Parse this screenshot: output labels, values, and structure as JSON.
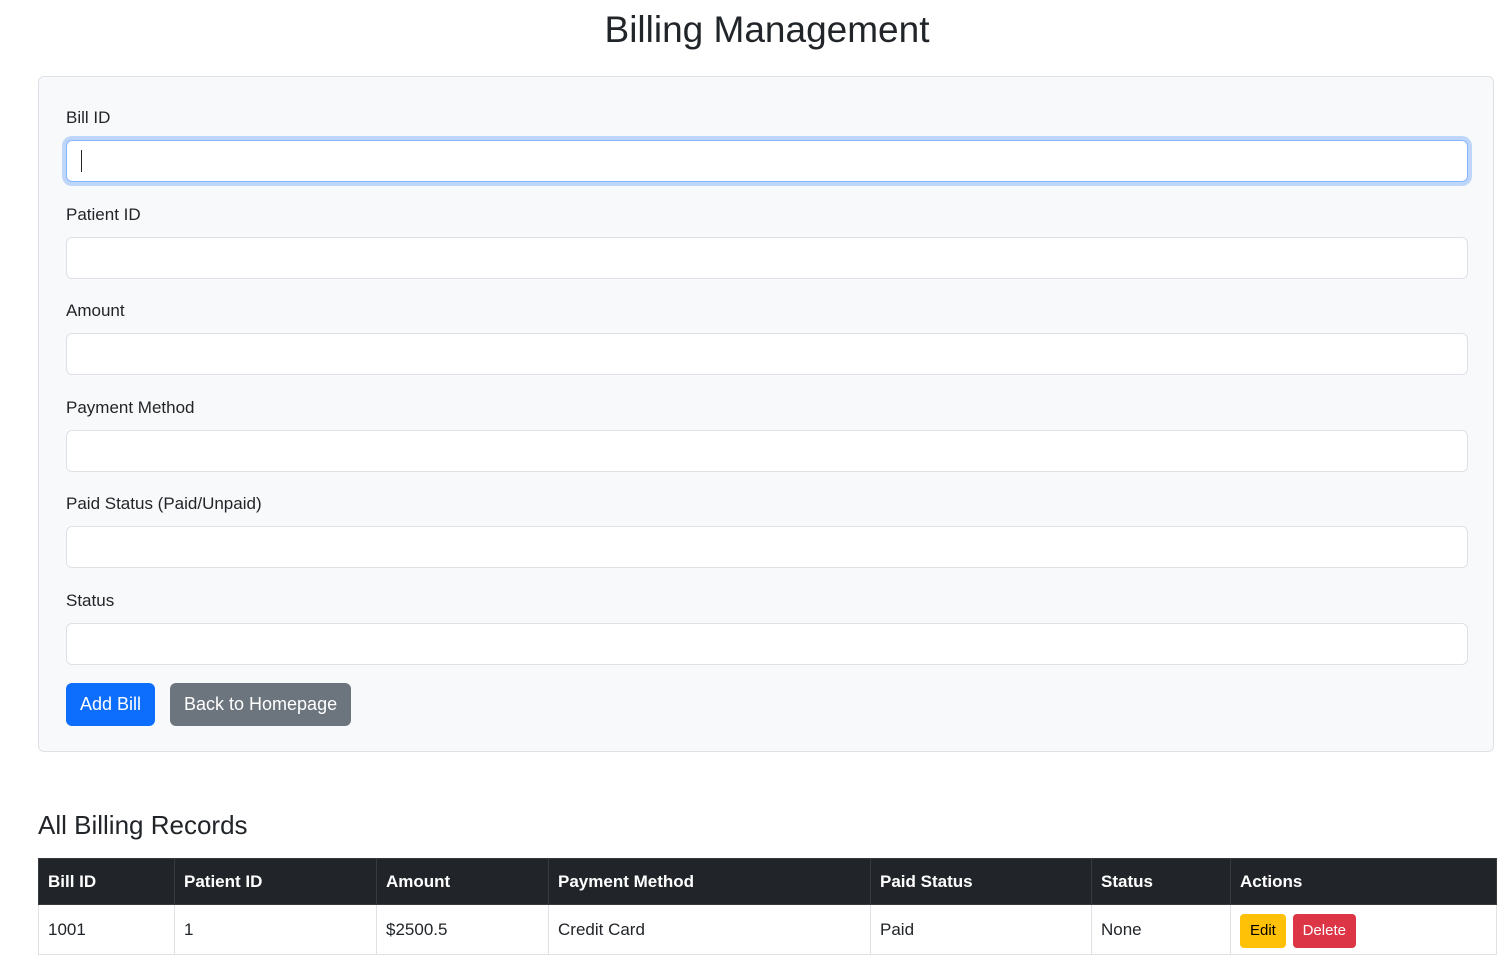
{
  "page": {
    "title": "Billing Management"
  },
  "form": {
    "fields": [
      {
        "label": "Bill ID",
        "value": "",
        "placeholder": ""
      },
      {
        "label": "Patient ID",
        "value": "",
        "placeholder": ""
      },
      {
        "label": "Amount",
        "value": "",
        "placeholder": ""
      },
      {
        "label": "Payment Method",
        "value": "",
        "placeholder": ""
      },
      {
        "label": "Paid Status (Paid/Unpaid)",
        "value": "",
        "placeholder": ""
      },
      {
        "label": "Status",
        "value": "",
        "placeholder": ""
      }
    ],
    "add_button": "Add Bill",
    "back_button": "Back to Homepage"
  },
  "records": {
    "title": "All Billing Records",
    "columns": [
      "Bill ID",
      "Patient ID",
      "Amount",
      "Payment Method",
      "Paid Status",
      "Status",
      "Actions"
    ],
    "rows": [
      {
        "bill_id": "1001",
        "patient_id": "1",
        "amount": "$2500.5",
        "payment_method": "Credit Card",
        "paid_status": "Paid",
        "status": "None",
        "edit_label": "Edit",
        "delete_label": "Delete"
      }
    ]
  },
  "colors": {
    "primary": "#0d6efd",
    "secondary": "#6c757d",
    "warning": "#ffc107",
    "danger": "#dc3545",
    "table_header": "#212529",
    "card_background": "#f8f9fa"
  }
}
